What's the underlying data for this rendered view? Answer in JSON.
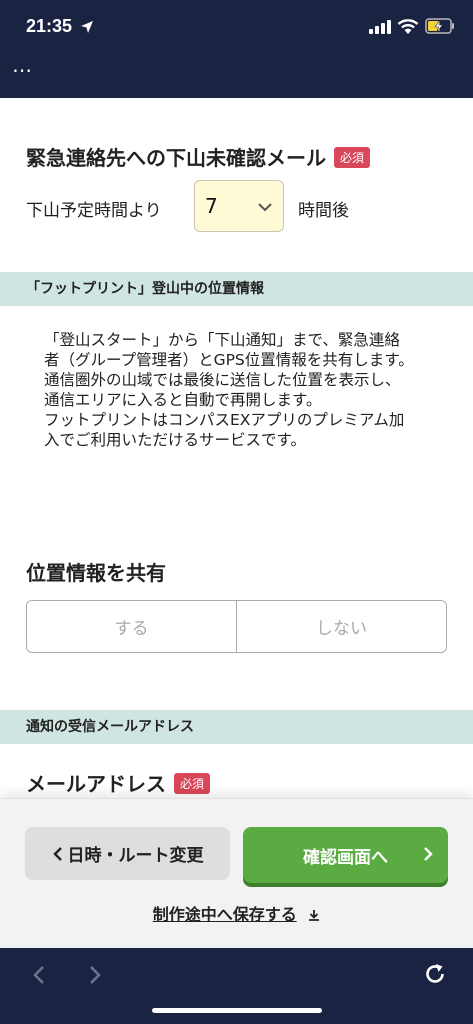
{
  "status_bar": {
    "time": "21:35",
    "icons": [
      "location-arrow-icon",
      "cellular-signal-icon",
      "wifi-icon",
      "battery-charging-icon"
    ]
  },
  "browser_top": {
    "more_label": "⋯"
  },
  "form": {
    "alert": {
      "title": "緊急連絡先への下山未確認メール",
      "required_badge": "必須",
      "prefix": "下山予定時間より",
      "hours_value": "7",
      "suffix": "時間後"
    },
    "footprint": {
      "section_title": "「フットプリント」登山中の位置情報",
      "description": [
        "「登山スタート」から「下山通知」まで、緊急連絡者（グループ管理者）とGPS位置情報を共有します。",
        "通信圏外の山域では最後に送信した位置を表示し、通信エリアに入ると自動で再開します。",
        "フットプリントはコンパスEXアプリのプレミアム加入でご利用いただけるサービスです。"
      ]
    },
    "share": {
      "title": "位置情報を共有",
      "options": [
        "する",
        "しない"
      ]
    },
    "mail": {
      "section_title": "通知の受信メールアドレス",
      "title": "メールアドレス",
      "required_badge": "必須"
    }
  },
  "actions": {
    "back_label": "日時・ルート変更",
    "confirm_label": "確認画面へ",
    "save_label": "制作途中へ保存する"
  },
  "colors": {
    "nav_bg": "#1b2343",
    "section_bg": "#cfe5e2",
    "required": "#d9485a",
    "confirm": "#5bab43",
    "select_bg": "#fffbd6"
  }
}
